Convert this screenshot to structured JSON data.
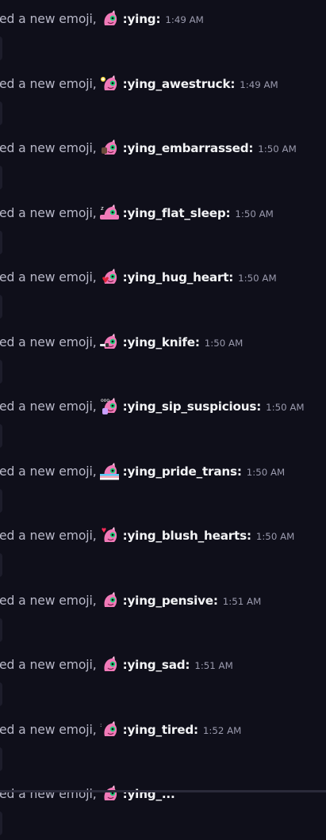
{
  "messages": [
    {
      "prefix": "ed a new emoji,",
      "name": ":ying:",
      "time": "1:49 AM",
      "emoji_icon": "ying-icon"
    },
    {
      "prefix": "ed a new emoji,",
      "name": ":ying_awestruck:",
      "time": "1:49 AM",
      "emoji_icon": "ying-awestruck-icon"
    },
    {
      "prefix": "ed a new emoji,",
      "name": ":ying_embarrassed:",
      "time": "1:50 AM",
      "emoji_icon": "ying-embarrassed-icon"
    },
    {
      "prefix": "ed a new emoji,",
      "name": ":ying_flat_sleep:",
      "time": "1:50 AM",
      "emoji_icon": "ying-flat-sleep-icon"
    },
    {
      "prefix": "ed a new emoji,",
      "name": ":ying_hug_heart:",
      "time": "1:50 AM",
      "emoji_icon": "ying-hug-heart-icon"
    },
    {
      "prefix": "ed a new emoji,",
      "name": ":ying_knife:",
      "time": "1:50 AM",
      "emoji_icon": "ying-knife-icon"
    },
    {
      "prefix": "ed a new emoji,",
      "name": ":ying_sip_suspicious:",
      "time": "1:50 AM",
      "emoji_icon": "ying-sip-suspicious-icon"
    },
    {
      "prefix": "ed a new emoji,",
      "name": ":ying_pride_trans:",
      "time": "1:50 AM",
      "emoji_icon": "ying-pride-trans-icon"
    },
    {
      "prefix": "ed a new emoji,",
      "name": ":ying_blush_hearts:",
      "time": "1:50 AM",
      "emoji_icon": "ying-blush-hearts-icon"
    },
    {
      "prefix": "ed a new emoji,",
      "name": ":ying_pensive:",
      "time": "1:51 AM",
      "emoji_icon": "ying-pensive-icon"
    },
    {
      "prefix": "ed a new emoji,",
      "name": ":ying_sad:",
      "time": "1:51 AM",
      "emoji_icon": "ying-sad-icon"
    },
    {
      "prefix": "ed a new emoji,",
      "name": ":ying_tired:",
      "time": "1:52 AM",
      "emoji_icon": "ying-tired-icon"
    },
    {
      "prefix": "ed a new emoji,",
      "name": ":ying_...",
      "time": "",
      "emoji_icon": "ying-icon"
    }
  ],
  "colors": {
    "background": "#0f0f1a",
    "prefix_text": "#b8b8c8",
    "emoji_name_text": "#f2f3f5",
    "timestamp_text": "#9a9aad",
    "emoji_pink": "#f07ab8"
  }
}
